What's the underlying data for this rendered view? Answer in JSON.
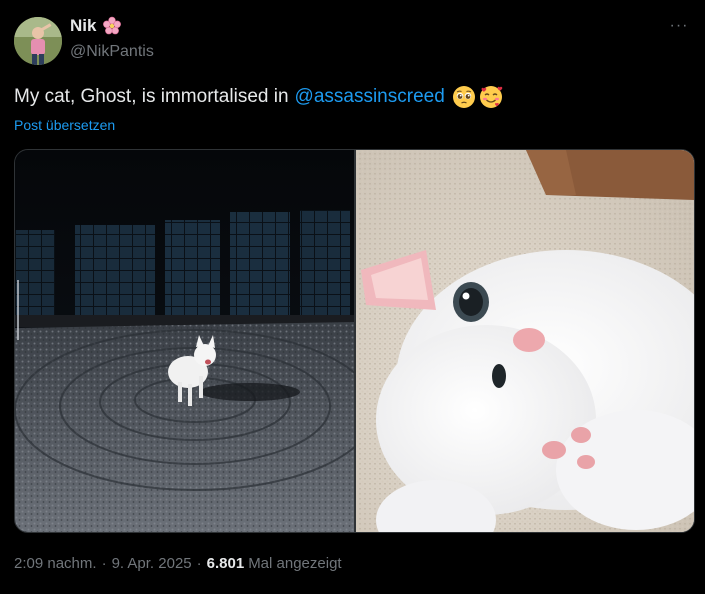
{
  "author": {
    "display_name": "Nik",
    "handle": "@NikPantis",
    "badge_icon": "cherry-blossom-icon"
  },
  "tweet": {
    "text_prefix": "My cat, Ghost, is immortalised in",
    "mention": "@assassinscreed",
    "emojis": [
      "pleading-face-icon",
      "smiling-face-with-hearts-icon"
    ],
    "translate_label": "Post übersetzen"
  },
  "media": [
    {
      "name": "game-screenshot-cat",
      "icon": "image"
    },
    {
      "name": "photo-white-cat",
      "icon": "image"
    }
  ],
  "meta": {
    "time": "2:09 nachm.",
    "separator": "·",
    "date": "9. Apr. 2025",
    "views_count": "6.801",
    "views_label": "Mal angezeigt"
  },
  "more_label": "···",
  "colors": {
    "background": "#000000",
    "text": "#e7e9ea",
    "muted": "#71767b",
    "link": "#1d9bf0"
  }
}
